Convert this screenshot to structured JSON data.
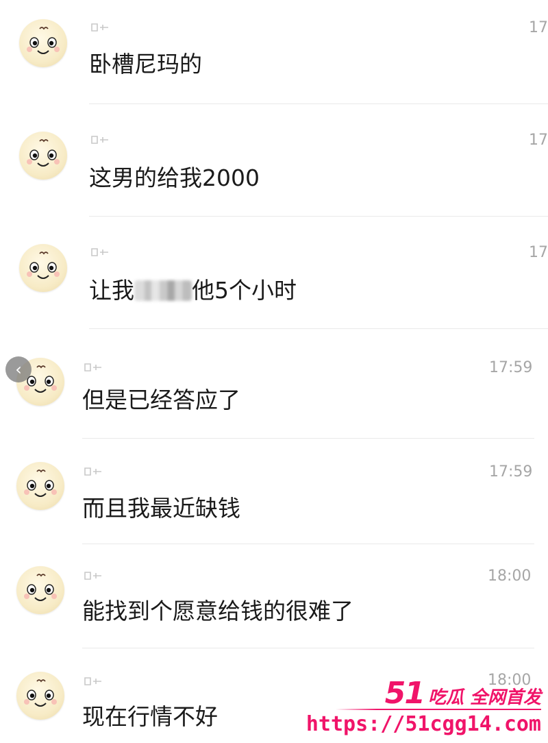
{
  "messages": [
    {
      "text": "卧槽尼玛的",
      "time": "17",
      "has_blur": false
    },
    {
      "text": "这男的给我2000",
      "time": "17",
      "has_blur": false
    },
    {
      "text_before": "让我",
      "text_after": "他5个小时",
      "time": "17",
      "has_blur": true
    },
    {
      "text": "但是已经答应了",
      "time": "17:59",
      "has_blur": false
    },
    {
      "text": "而且我最近缺钱",
      "time": "17:59",
      "has_blur": false
    },
    {
      "text": "能找到个愿意给钱的很难了",
      "time": "18:00",
      "has_blur": false
    },
    {
      "text": "现在行情不好",
      "time": "18:00",
      "has_blur": false
    }
  ],
  "controls": {
    "back_glyph": "‹"
  },
  "watermark": {
    "number": "51",
    "brand_text": "吃瓜 全网首发",
    "url": "https://51cgg14.com"
  },
  "colors": {
    "accent": "#f01469",
    "timestamp": "#a6a6a6",
    "text": "#1a1a1a"
  }
}
